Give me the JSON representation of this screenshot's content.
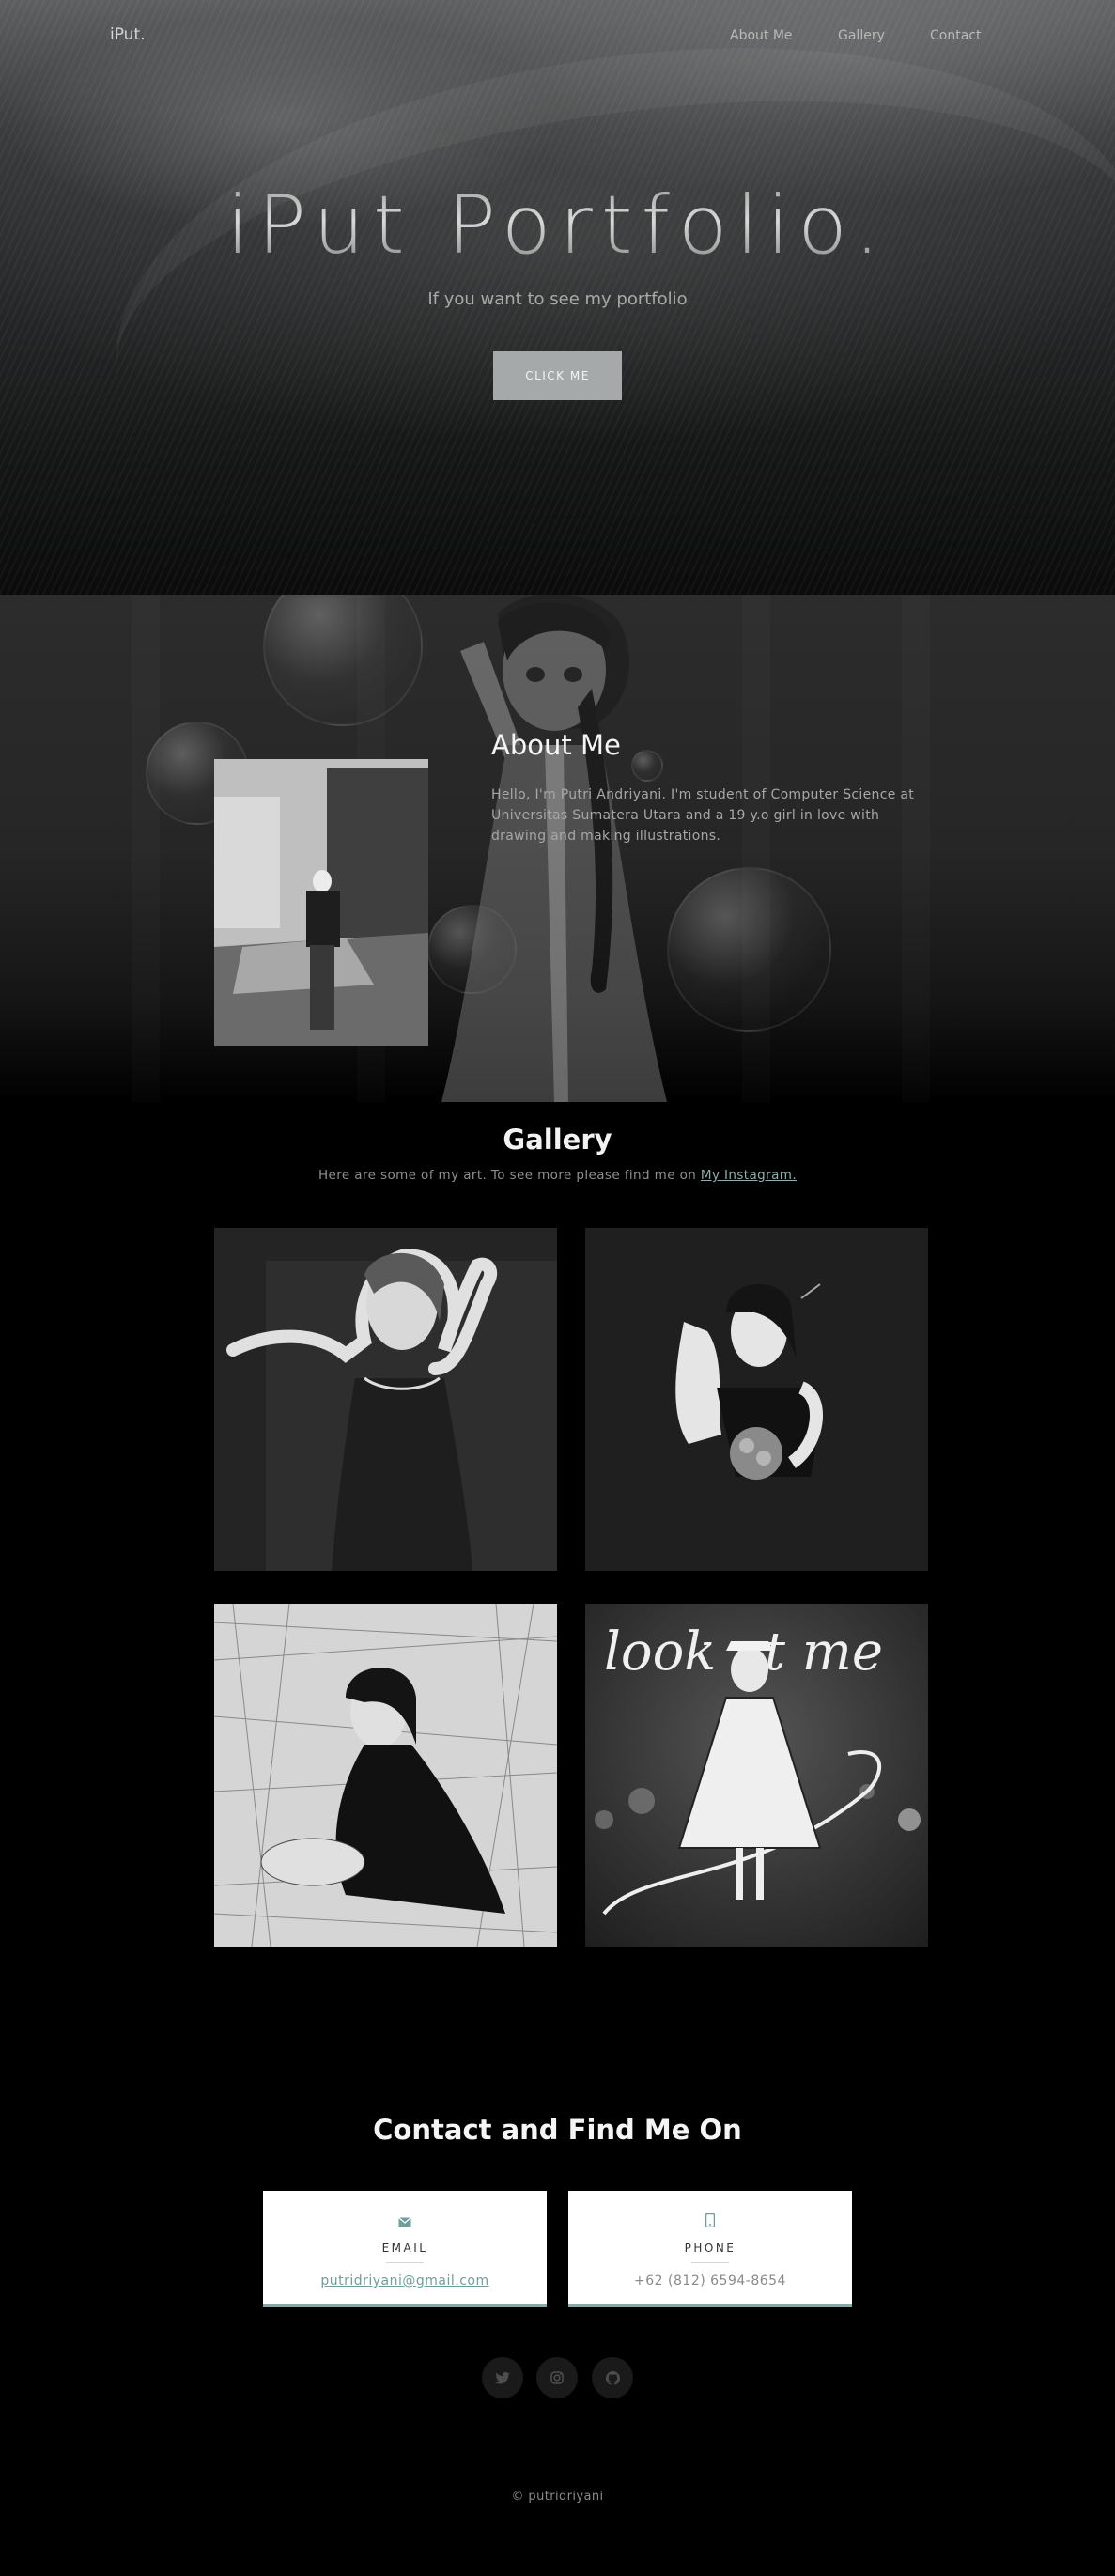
{
  "nav": {
    "brand": "iPut.",
    "links": [
      {
        "label": "About Me"
      },
      {
        "label": "Gallery"
      },
      {
        "label": "Contact"
      }
    ]
  },
  "hero": {
    "title": "iPut Portfolio.",
    "subtitle": "If you want to see my portfolio",
    "button_label": "CLICK ME"
  },
  "about": {
    "title": "About Me",
    "text": "Hello, I'm Putri Andriyani. I'm student of Computer Science at Universitas Sumatera Utara and a 19 y.o girl in love with drawing and making illustrations."
  },
  "gallery": {
    "title": "Gallery",
    "subtitle_prefix": "Here are some of my art. To see more please find me on ",
    "subtitle_link": "My Instagram.",
    "artworks": [
      {
        "icon": "artwork-girl-dress"
      },
      {
        "icon": "artwork-girl-bouquet"
      },
      {
        "icon": "artwork-girl-sketch"
      },
      {
        "icon": "artwork-look-at-me",
        "text": "look at me"
      }
    ]
  },
  "contact": {
    "title": "Contact and Find Me On",
    "email": {
      "label": "EMAIL",
      "value": "putridriyani@gmail.com",
      "icon": "envelope-icon"
    },
    "phone": {
      "label": "PHONE",
      "value": "+62 (812) 6594-8654",
      "icon": "mobile-phone-icon"
    }
  },
  "social": [
    {
      "icon": "twitter-icon",
      "glyph": "🐦"
    },
    {
      "icon": "instagram-icon",
      "glyph": "◎"
    },
    {
      "icon": "github-icon",
      "glyph": "●"
    }
  ],
  "footer": {
    "copyright": "© putridriyani"
  },
  "colors": {
    "accent": "#6f9f9a",
    "button": "#a6a9a9",
    "background": "#000000"
  }
}
